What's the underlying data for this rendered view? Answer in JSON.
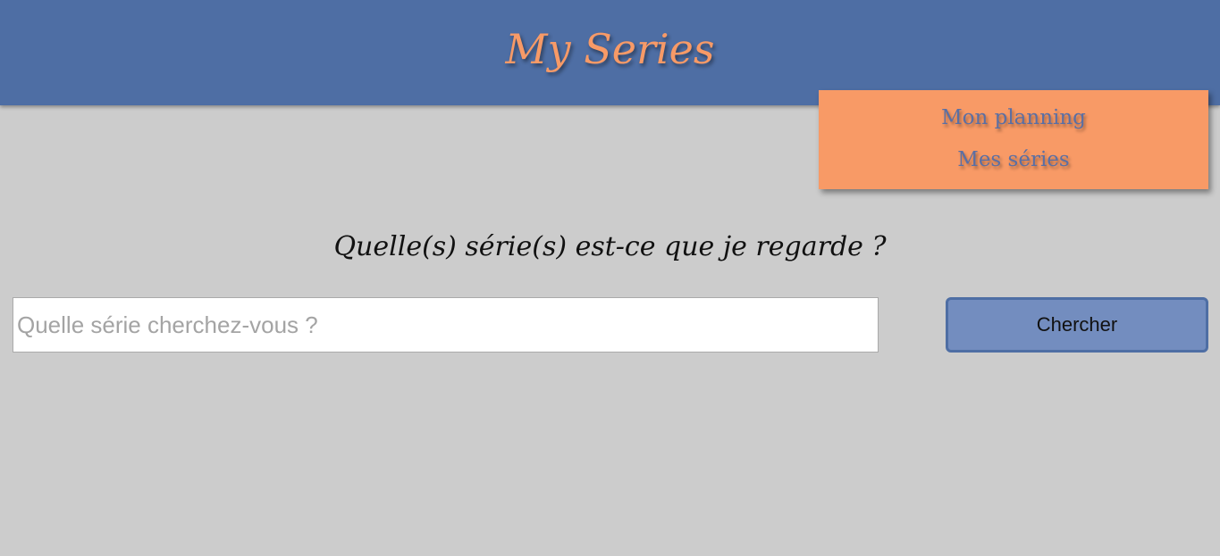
{
  "header": {
    "title": "My Series"
  },
  "nav": {
    "items": [
      {
        "label": "Mon planning"
      },
      {
        "label": "Mes séries"
      }
    ]
  },
  "main": {
    "question": "Quelle(s) série(s) est-ce que je regarde ?",
    "search": {
      "value": "",
      "placeholder": "Quelle série cherchez-vous ?",
      "button_label": "Chercher"
    }
  },
  "colors": {
    "header_bg": "#4e6ea4",
    "title_color": "#f79a67",
    "nav_bg": "#f89a66",
    "nav_link_color": "#5b6fa3",
    "page_bg": "#cccccc",
    "button_bg": "#738dbf",
    "button_border": "#4e6ea4"
  }
}
